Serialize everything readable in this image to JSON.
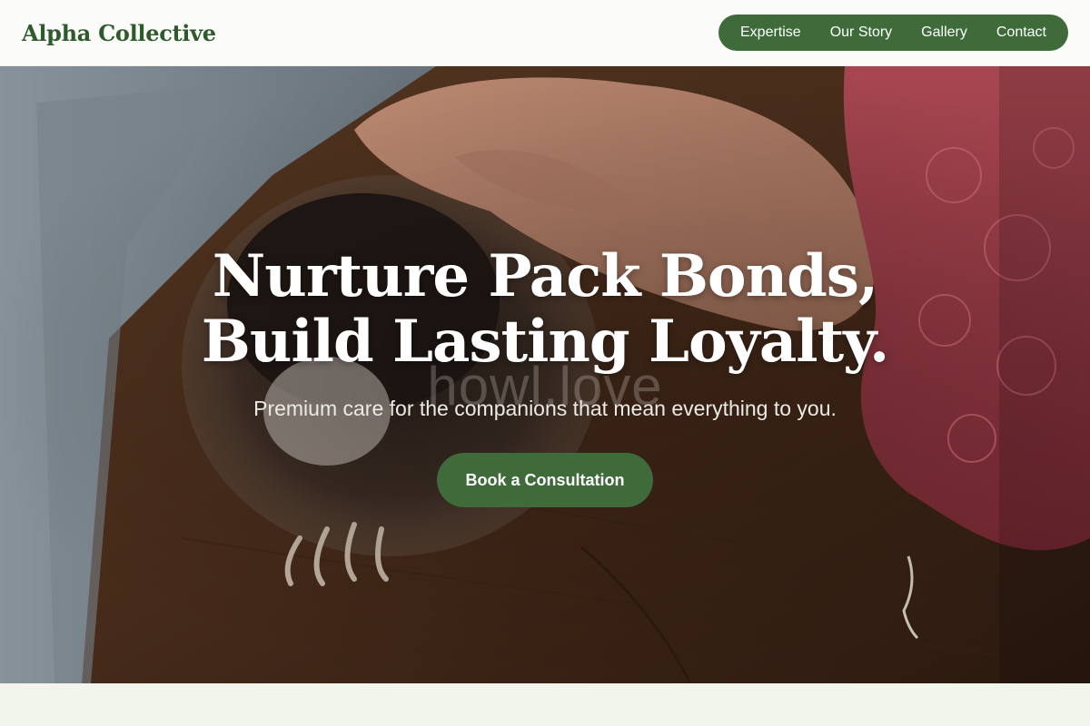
{
  "header": {
    "brand": "Alpha Collective",
    "nav": [
      {
        "label": "Expertise"
      },
      {
        "label": "Our Story"
      },
      {
        "label": "Gallery"
      },
      {
        "label": "Contact"
      }
    ]
  },
  "hero": {
    "headline_line1": "Nurture Pack Bonds,",
    "headline_line2": "Build Lasting Loyalty.",
    "watermark": "howl.love",
    "subtitle": "Premium care for the companions that mean everything to you.",
    "cta_label": "Book a Consultation"
  },
  "colors": {
    "brand_green": "#3f6b3b",
    "brand_text": "#2e5a2c",
    "header_bg": "#fbfcf9",
    "section_bg": "#f2f5ec"
  }
}
